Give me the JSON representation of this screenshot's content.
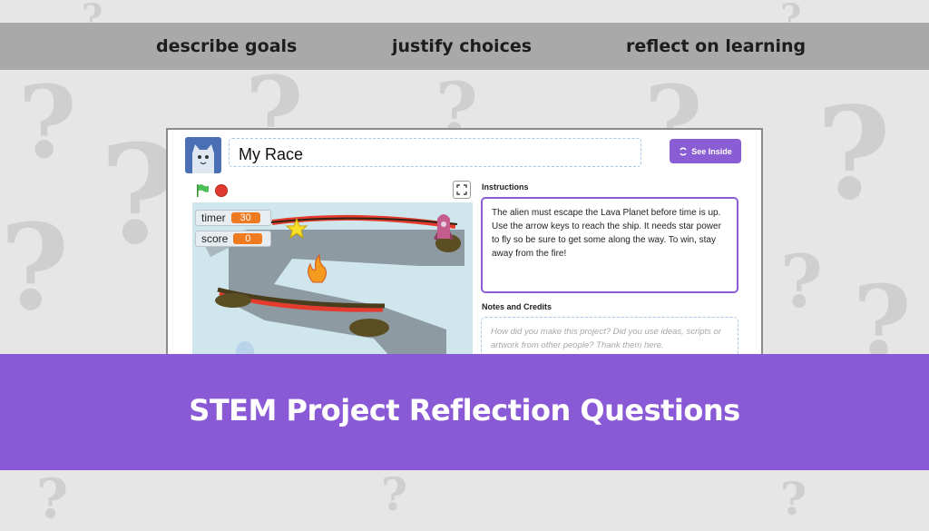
{
  "top_bar": {
    "item1": "describe goals",
    "item2": "justify choices",
    "item3": "reflect on learning"
  },
  "project": {
    "title": "My Race",
    "see_inside_label": "See Inside",
    "stage": {
      "monitors": [
        {
          "name": "timer",
          "value": "30"
        },
        {
          "name": "score",
          "value": "0"
        }
      ]
    },
    "instructions_heading": "Instructions",
    "instructions_text": "The alien must escape the Lava Planet before time is up. Use the arrow keys to reach the ship. It needs star power to fly so be sure to get some along the way. To win, stay away from the fire!",
    "notes_heading": "Notes and Credits",
    "notes_placeholder": "How did you make this project? Did you use ideas, scripts or artwork from other people? Thank them here."
  },
  "banner": {
    "title": "STEM Project Reflection Questions"
  },
  "colors": {
    "accent_purple": "#8a5ad6",
    "top_bar_gray": "#a9a9a9",
    "monitor_orange": "#f07a1f"
  },
  "icons": [
    "green-flag-icon",
    "stop-icon",
    "fullscreen-icon",
    "see-inside-icon",
    "cat-avatar-icon",
    "question-mark-icon"
  ]
}
